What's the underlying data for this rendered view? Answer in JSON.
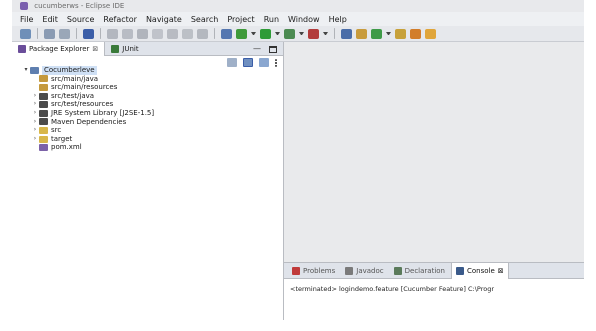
{
  "window": {
    "title": "cucumberws - Eclipse IDE"
  },
  "menu": [
    "File",
    "Edit",
    "Source",
    "Refactor",
    "Navigate",
    "Search",
    "Project",
    "Run",
    "Window",
    "Help"
  ],
  "toolbar_icons": [
    {
      "name": "new-icon",
      "color": "#6f8fb8"
    },
    {
      "name": "sep"
    },
    {
      "name": "save-icon",
      "color": "#8a9bb3"
    },
    {
      "name": "save-all-icon",
      "color": "#9aa7b8"
    },
    {
      "name": "sep"
    },
    {
      "name": "cursor-icon",
      "color": "#3b5ea8"
    },
    {
      "name": "sep"
    },
    {
      "name": "skip-icon",
      "color": "#b3b7bf"
    },
    {
      "name": "resume-icon",
      "color": "#b8bcc4"
    },
    {
      "name": "suspend-icon",
      "color": "#b0b4bc"
    },
    {
      "name": "terminate-icon",
      "color": "#c0c3ca"
    },
    {
      "name": "step-into-icon",
      "color": "#b8bbc2"
    },
    {
      "name": "step-over-icon",
      "color": "#bcc0c6"
    },
    {
      "name": "step-return-icon",
      "color": "#b4b8bf"
    },
    {
      "name": "sep"
    },
    {
      "name": "java-perspective-icon",
      "color": "#5577b0"
    },
    {
      "name": "debug-icon",
      "color": "#3f9a3a"
    },
    {
      "name": "dd"
    },
    {
      "name": "run-icon",
      "color": "#2f9b38"
    },
    {
      "name": "dd"
    },
    {
      "name": "coverage-icon",
      "color": "#4c8b52"
    },
    {
      "name": "dd"
    },
    {
      "name": "external-tools-icon",
      "color": "#b23b3b"
    },
    {
      "name": "dd"
    },
    {
      "name": "sep"
    },
    {
      "name": "new-java-project-icon",
      "color": "#4a6da8"
    },
    {
      "name": "new-package-icon",
      "color": "#c89b3c"
    },
    {
      "name": "new-class-icon",
      "color": "#3e9a48"
    },
    {
      "name": "dd"
    },
    {
      "name": "open-type-icon",
      "color": "#c7a13a"
    },
    {
      "name": "search-icon",
      "color": "#d27d2a"
    },
    {
      "name": "next-annotation-icon",
      "color": "#e0a53a"
    }
  ],
  "left_panel": {
    "tabs": [
      {
        "label": "Package Explorer",
        "close": "⊠",
        "icon_color": "#6a4d9a"
      },
      {
        "label": "JUnit",
        "icon_color": "#3a7a3a"
      }
    ],
    "controls": {
      "minimize": "—"
    }
  },
  "tree": [
    {
      "label": "Cocumberleve",
      "depth": 0,
      "twisty": "▾",
      "icon": "project-icon",
      "color": "#5f7fb0",
      "selected": true
    },
    {
      "label": "src/main/java",
      "depth": 1,
      "twisty": "",
      "icon": "source-folder-icon",
      "color": "#c59a3e"
    },
    {
      "label": "src/main/resources",
      "depth": 1,
      "twisty": "",
      "icon": "source-folder-icon",
      "color": "#c59a3e"
    },
    {
      "label": "src/test/java",
      "depth": 1,
      "twisty": "›",
      "icon": "source-folder-icon",
      "color": "#4b4b4b"
    },
    {
      "label": "src/test/resources",
      "depth": 1,
      "twisty": "›",
      "icon": "source-folder-icon",
      "color": "#4b4b4b"
    },
    {
      "label": "JRE System Library [J2SE-1.5]",
      "depth": 1,
      "twisty": "›",
      "icon": "library-icon",
      "color": "#4b4b4b"
    },
    {
      "label": "Maven Dependencies",
      "depth": 1,
      "twisty": "›",
      "icon": "library-icon",
      "color": "#4b4b4b"
    },
    {
      "label": "src",
      "depth": 1,
      "twisty": "›",
      "icon": "folder-icon",
      "color": "#d8b74a"
    },
    {
      "label": "target",
      "depth": 1,
      "twisty": "›",
      "icon": "folder-icon",
      "color": "#d8b74a"
    },
    {
      "label": "pom.xml",
      "depth": 1,
      "twisty": "",
      "icon": "xml-file-icon",
      "color": "#7c62a8"
    }
  ],
  "bottom_panel": {
    "tabs": [
      {
        "label": "Problems",
        "icon": "problems-icon",
        "color": "#c03a3a",
        "active": false,
        "close": ""
      },
      {
        "label": "Javadoc",
        "icon": "javadoc-icon",
        "color": "#7a7a7a",
        "active": false,
        "close": ""
      },
      {
        "label": "Declaration",
        "icon": "declaration-icon",
        "color": "#5a7a5a",
        "active": false,
        "close": ""
      },
      {
        "label": "Console",
        "icon": "console-icon",
        "color": "#3a5a8a",
        "active": true,
        "close": "⊠"
      }
    ],
    "console_line": "<terminated> logindemo.feature [Cucumber Feature] C:\\Progr"
  }
}
